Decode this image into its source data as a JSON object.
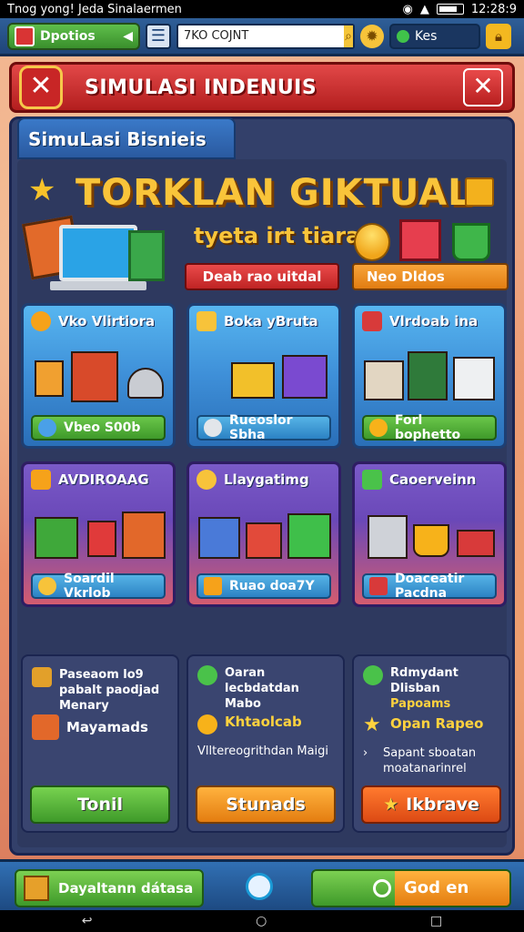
{
  "status_bar": {
    "left_text": "Tnog yong! Jeda Sinalaermen",
    "time": "12:28:9"
  },
  "top_bar": {
    "options_label": "Dpotios",
    "search_value": "7KO COJNT",
    "resource_label": "Kes"
  },
  "banner": {
    "title": "SIMULASI INDENUIS",
    "close_symbol": "✕",
    "badge_symbol": "✕"
  },
  "tab": {
    "label": "SimuLasi Bisnieis"
  },
  "hero": {
    "title": "TORKLAN GIKTUAL",
    "subtitle": "tyeta irt tiarani",
    "red_button": "Deab rao uitdal",
    "orange_button": "Neo Dldos"
  },
  "cards": [
    {
      "title": "Vko Vlirtiora",
      "footer": "Vbeo S00b"
    },
    {
      "title": "Boka yBruta",
      "footer": "Rueoslor Sbha"
    },
    {
      "title": "Vlrdoab ina",
      "footer": "Forl bophetto"
    },
    {
      "title": "AVDIROAAG",
      "footer": "Soardil Vkrlob"
    },
    {
      "title": "Llaygatimg",
      "footer": "Ruao doa7Y"
    },
    {
      "title": "Caoerveinn",
      "footer": "Doaceatir Pacdna"
    }
  ],
  "columns": [
    {
      "rows": [
        "Paseaom lo9 pabalt paodjad Menary",
        "Mayamads"
      ],
      "button": "Tonil"
    },
    {
      "rows": [
        "Oaran lecbdatdan Mabo",
        "Khtaolcab",
        "Vlltereogrithdan Maigi"
      ],
      "button": "Stunads"
    },
    {
      "rows": [
        "Rdmydant Dlisban",
        "Papoams",
        "Opan Rapeo",
        "Sapant sboatan moatanarinrel"
      ],
      "button": "Ikbrave"
    }
  ],
  "footer": {
    "left_label": "Dayaltann dátasa",
    "right_label": "God en"
  },
  "colors": {
    "accent_red": "#d93434",
    "accent_gold": "#f9c43a",
    "panel": "#33406a"
  }
}
